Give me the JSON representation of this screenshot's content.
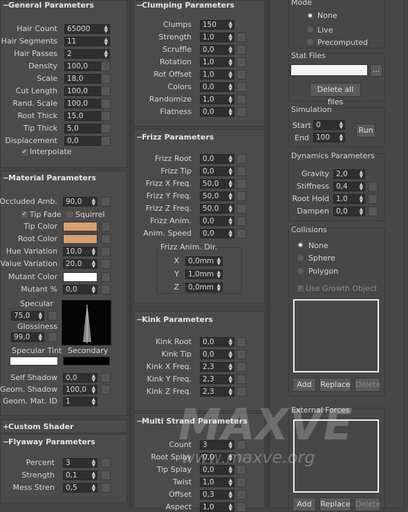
{
  "general": {
    "title": "General Parameters",
    "rows": [
      {
        "label": "Hair Count",
        "value": "65000"
      },
      {
        "label": "Hair Segments",
        "value": "11"
      },
      {
        "label": "Hair Passes",
        "value": "2"
      },
      {
        "label": "Density",
        "value": "100,0"
      },
      {
        "label": "Scale",
        "value": "18,0"
      },
      {
        "label": "Cut Length",
        "value": "100,0"
      },
      {
        "label": "Rand. Scale",
        "value": "100,0"
      },
      {
        "label": "Root Thick",
        "value": "15,0"
      },
      {
        "label": "Tip Thick",
        "value": "5,0"
      },
      {
        "label": "Displacement",
        "value": "0,0"
      }
    ],
    "interpolate": "Interpolate"
  },
  "material": {
    "title": "Material Parameters",
    "occluded_label": "Occluded Amb.",
    "occluded_value": "90,0",
    "tip_fade": "Tip Fade",
    "squirrel": "Squirrel",
    "tip_color": "Tip Color",
    "root_color": "Root Color",
    "hue_label": "Hue Variation",
    "hue_value": "10,0",
    "val_label": "Value Variation",
    "val_value": "20,0",
    "mutant_color": "Mutant Color",
    "mutant_pct_label": "Mutant %",
    "mutant_pct_value": "0,0",
    "specular_label": "Specular",
    "specular_value": "75,0",
    "gloss_label": "Glossiness",
    "gloss_value": "99,0",
    "spec_tint": "Specular Tint",
    "secondary": "Secondary",
    "self_shadow_label": "Self Shadow",
    "self_shadow_value": "0,0",
    "geom_shadow_label": "Geom. Shadow",
    "geom_shadow_value": "100,0",
    "geom_mat_label": "Geom. Mat. ID",
    "geom_mat_value": "1",
    "colors": {
      "tip": "#d7a070",
      "root": "#d7a070",
      "mutant": "#ffffff",
      "tint": "#ffffff",
      "secondary": "#000000"
    }
  },
  "custom_shader": {
    "title": "Custom Shader"
  },
  "flyaway": {
    "title": "Flyaway Parameters",
    "rows": [
      {
        "label": "Percent",
        "value": "3"
      },
      {
        "label": "Strength",
        "value": "0,1"
      },
      {
        "label": "Mess Stren",
        "value": "0,5"
      }
    ]
  },
  "clumping": {
    "title": "Clumping Parameters",
    "rows": [
      {
        "label": "Clumps",
        "value": "150"
      },
      {
        "label": "Strength",
        "value": "1,0"
      },
      {
        "label": "Scruffle",
        "value": "0,0"
      },
      {
        "label": "Rotation",
        "value": "1,0"
      },
      {
        "label": "Rot Offset",
        "value": "1,0"
      },
      {
        "label": "Colors",
        "value": "0,0"
      },
      {
        "label": "Randomize",
        "value": "1,0"
      },
      {
        "label": "Flatness",
        "value": "0,0"
      }
    ]
  },
  "frizz": {
    "title": "Frizz Parameters",
    "rows": [
      {
        "label": "Frizz Root",
        "value": "0,0"
      },
      {
        "label": "Frizz Tip",
        "value": "0,0"
      },
      {
        "label": "Frizz X Freq.",
        "value": "50,0"
      },
      {
        "label": "Frizz Y Freq.",
        "value": "50,0"
      },
      {
        "label": "Frizz Z Freq.",
        "value": "50,0"
      },
      {
        "label": "Frizz Anim.",
        "value": "0,0"
      },
      {
        "label": "Anim. Speed",
        "value": "0,0"
      }
    ],
    "dir_title": "Frizz Anim. Dir.",
    "dir": [
      {
        "label": "X",
        "value": "0,0mm"
      },
      {
        "label": "Y",
        "value": "1,0mm"
      },
      {
        "label": "Z",
        "value": "0,0mm"
      }
    ]
  },
  "kink": {
    "title": "Kink Parameters",
    "rows": [
      {
        "label": "Kink Root",
        "value": "0,0"
      },
      {
        "label": "Kink Tip",
        "value": "0,0"
      },
      {
        "label": "Kink X Freq.",
        "value": "2,3"
      },
      {
        "label": "Kink Y Freq.",
        "value": "2,3"
      },
      {
        "label": "Kink Z Freq.",
        "value": "2,3"
      }
    ]
  },
  "multi": {
    "title": "Multi Strand Parameters",
    "rows": [
      {
        "label": "Count",
        "value": "3"
      },
      {
        "label": "Root Splay",
        "value": "0,0"
      },
      {
        "label": "Tip Splay",
        "value": "0,0"
      },
      {
        "label": "Twist",
        "value": "1,0"
      },
      {
        "label": "Offset",
        "value": "0,3"
      },
      {
        "label": "Aspect",
        "value": "1,0"
      }
    ]
  },
  "dynamics": {
    "mode_title": "Mode",
    "modes": [
      "None",
      "Live",
      "Precomputed"
    ],
    "stat_title": "Stat Files",
    "browse": "...",
    "delete_all": "Delete all files",
    "sim_title": "Simulation",
    "start_label": "Start",
    "start_value": "0",
    "end_label": "End",
    "end_value": "100",
    "run": "Run",
    "dyn_title": "Dynamics Parameters",
    "params": [
      {
        "label": "Gravity",
        "value": "2,0"
      },
      {
        "label": "Stiffness",
        "value": "0,4"
      },
      {
        "label": "Root Hold",
        "value": "1,0"
      },
      {
        "label": "Dampen",
        "value": "0,0"
      }
    ],
    "coll_title": "Collisions",
    "collisions": [
      "None",
      "Sphere",
      "Polygon"
    ],
    "growth": "Use Growth Object",
    "add": "Add",
    "replace": "Replace",
    "delete": "Delete",
    "ext_title": "External Forces"
  },
  "watermark": {
    "big": "MAXVE",
    "url": "www.maxve.org"
  }
}
